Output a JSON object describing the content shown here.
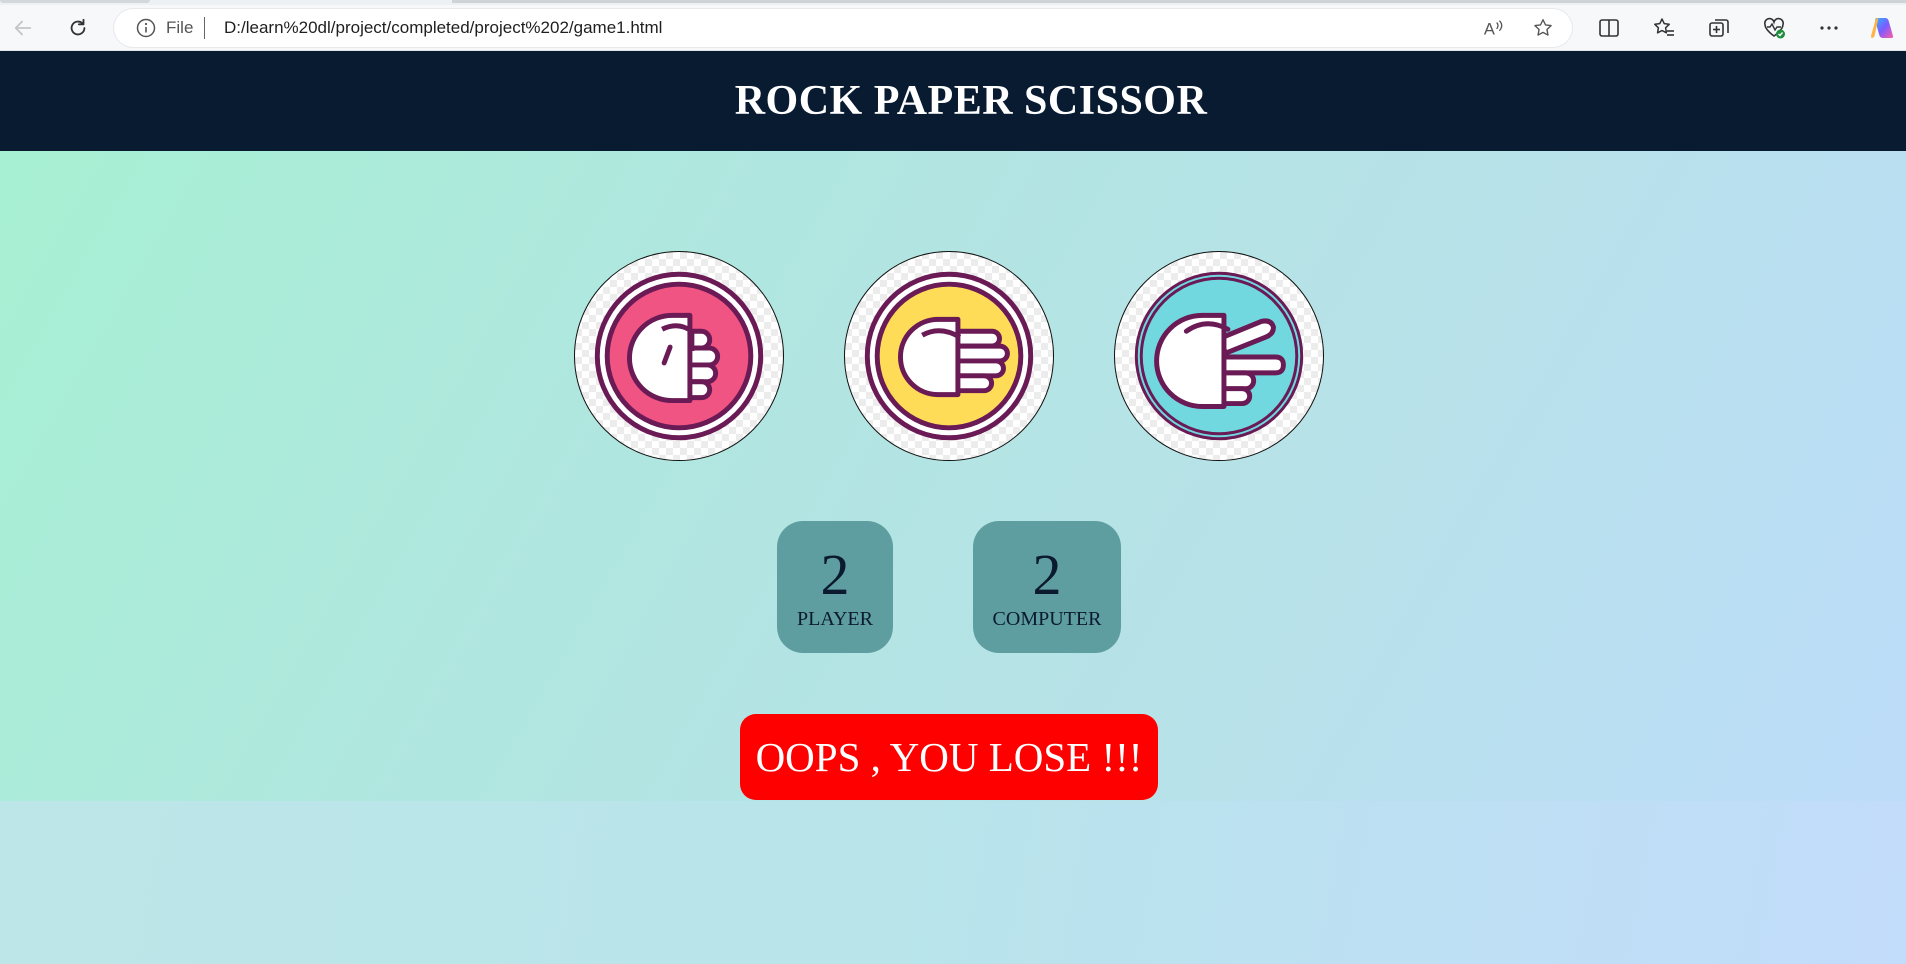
{
  "browser": {
    "url_scheme": "File",
    "url": "D:/learn%20dl/project/completed/project%202/game1.html",
    "icons": [
      "back-arrow-icon",
      "refresh-icon",
      "info-icon",
      "read-aloud-icon",
      "favorite-star-icon",
      "split-screen-icon",
      "favorites-icon",
      "collections-icon",
      "browser-essentials-icon",
      "more-icon",
      "copilot-icon"
    ]
  },
  "page": {
    "title": "ROCK PAPER SCISSOR",
    "choices": [
      {
        "name": "rock",
        "color": "#ef5483"
      },
      {
        "name": "paper",
        "color": "#ffdc58"
      },
      {
        "name": "scissors",
        "color": "#72d8e0"
      }
    ],
    "scores": {
      "player": {
        "value": "2",
        "label": "PLAYER"
      },
      "computer": {
        "value": "2",
        "label": "COMPUTER"
      }
    },
    "message": "OOPS , YOU LOSE !!!",
    "colors": {
      "header_bg": "#081b31",
      "score_bg": "#5f9ea0",
      "message_bg": "#ff0000",
      "outline": "#6a1a55"
    }
  }
}
